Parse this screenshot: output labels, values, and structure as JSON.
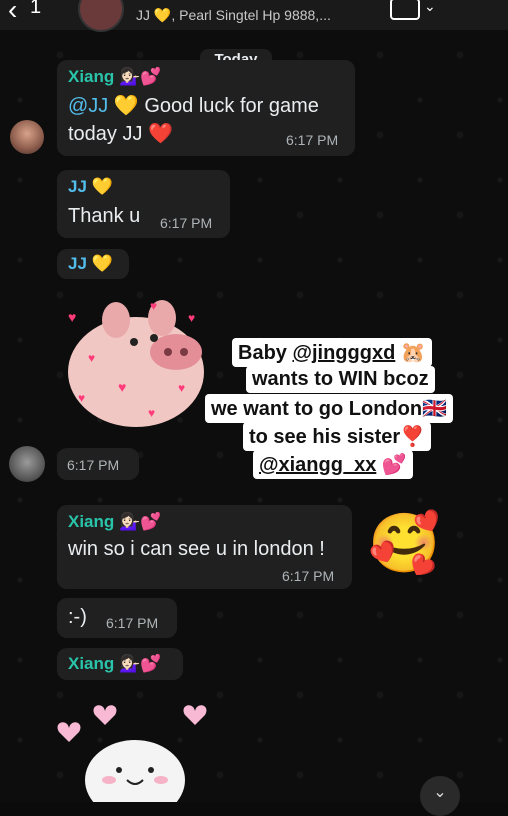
{
  "header": {
    "back_icon": "chevron-left-icon",
    "back_count": "1",
    "subtitle": "JJ 💛, Pearl Singtel Hp 9888,...",
    "video_icon": "video-call-icon"
  },
  "date_label": "Today",
  "messages": [
    {
      "sender": "Xiang 💁🏻‍♀️💕",
      "line1_mention": "@JJ",
      "line1_rest": "💛 Good luck for game",
      "line2": "today JJ ❤️",
      "time": "6:17 PM"
    },
    {
      "sender": "JJ 💛",
      "text": "Thank u",
      "time": "6:17 PM"
    },
    {
      "sender": "JJ 💛"
    },
    {
      "time": "6:17 PM"
    },
    {
      "sender": "Xiang 💁🏻‍♀️💕",
      "text": "win so i can see u in london !",
      "time": "6:17 PM"
    },
    {
      "text": ":-)",
      "time": "6:17 PM"
    },
    {
      "sender": "Xiang 💁🏻‍♀️💕"
    }
  ],
  "story": {
    "l1_pre": "Baby ",
    "l1_handle": "@jingggxd",
    "l1_post": " 🐹",
    "l2": "wants to WIN bcoz",
    "l3": "we want to go London🇬🇧",
    "l4": "to see his sister❣️",
    "l5_handle": "@xiangg_xx",
    "l5_post": " 💕"
  },
  "emoji_reaction": "🥰",
  "scroll_icon": "chevron-down-icon",
  "colors": {
    "bubble": "#202020",
    "sender_blue": "#53bdeb",
    "sender_teal": "#29c4a9",
    "timestamp": "#aeb4b7"
  }
}
